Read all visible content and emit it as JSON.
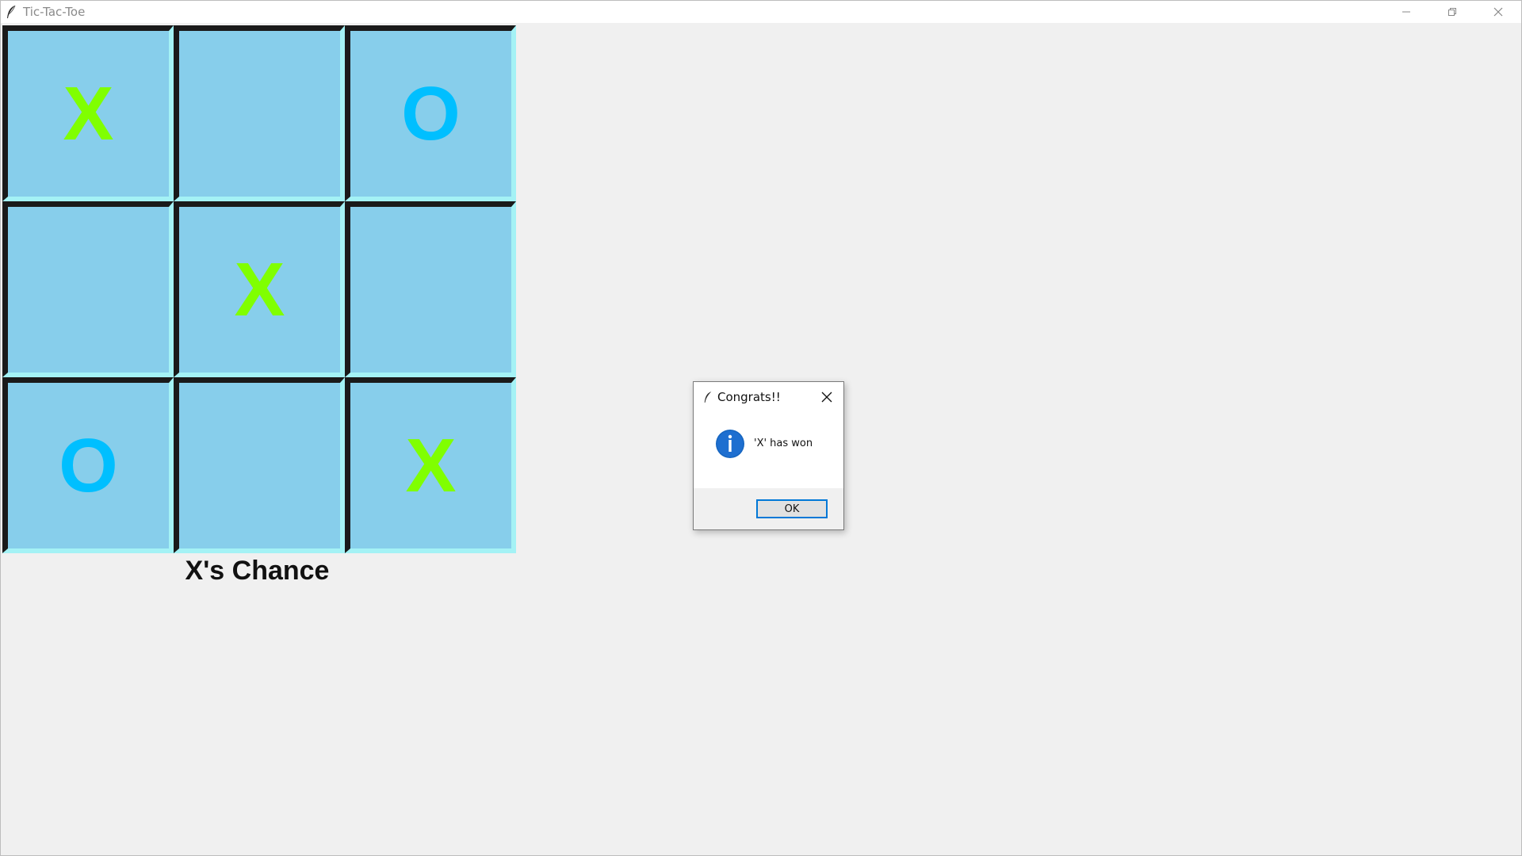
{
  "window": {
    "title": "Tic-Tac-Toe",
    "icon": "feather-icon",
    "controls": {
      "minimize": "—",
      "restore": "❐",
      "close": "✕"
    }
  },
  "board": {
    "cells": [
      [
        "X",
        "",
        "O"
      ],
      [
        "",
        "X",
        ""
      ],
      [
        "O",
        "",
        "X"
      ]
    ]
  },
  "status": {
    "text": "X's Chance"
  },
  "dialog": {
    "title": "Congrats!!",
    "icon": "info-icon",
    "message": "'X' has won",
    "ok_label": "OK"
  },
  "colors": {
    "cell_bg": "#87ceeb",
    "x_color": "#80ff00",
    "o_color": "#00bfff",
    "accent": "#0078d7"
  }
}
